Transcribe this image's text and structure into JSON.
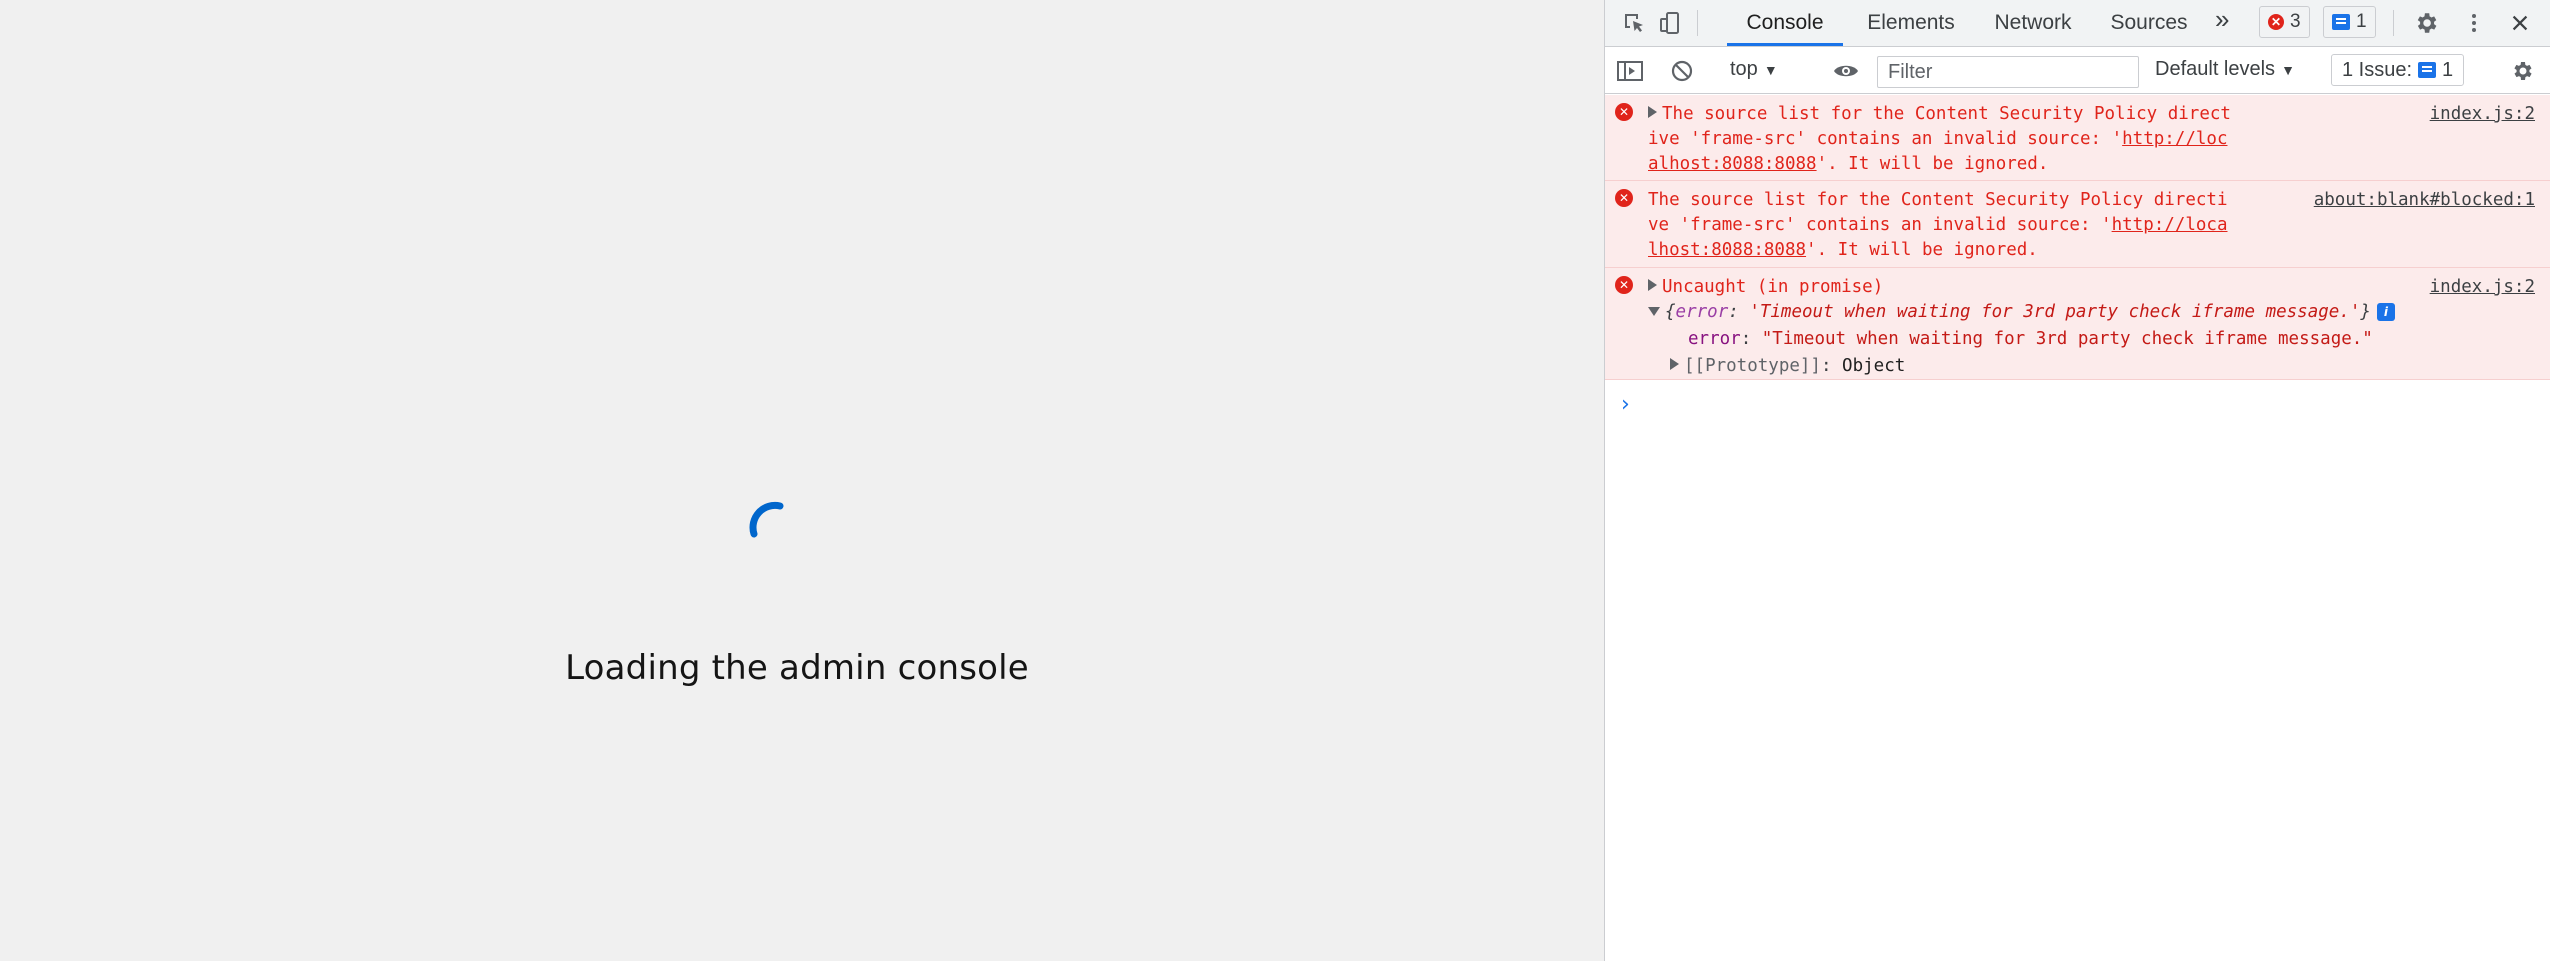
{
  "page": {
    "loading_text": "Loading the admin console"
  },
  "devtools": {
    "tabs": [
      "Console",
      "Elements",
      "Network",
      "Sources"
    ],
    "overflow_symbol": "»",
    "error_count": "3",
    "message_count": "1",
    "toolbar": {
      "context": "top",
      "filter_placeholder": "Filter",
      "levels": "Default levels",
      "issues_label": "1 Issue:",
      "issues_count": "1"
    },
    "messages": [
      {
        "prefix": "The source list for the Content Security Policy directive 'frame-src' contains an invalid source: '",
        "link": "http://localhost:8088:8088",
        "suffix": "'. It will be ignored.",
        "source": "index.js:2"
      },
      {
        "prefix": "The source list for the Content Security Policy directive 'frame-src' contains an invalid source: '",
        "link": "http://localhost:8088:8088",
        "suffix": "'. It will be ignored.",
        "source": "about:blank#blocked:1"
      },
      {
        "title": "Uncaught (in promise)",
        "source": "index.js:2",
        "object_preview_key": "error",
        "object_preview_value": "'Timeout when waiting for 3rd party check iframe message.'",
        "prop_key": "error",
        "prop_value": "\"Timeout when waiting for 3rd party check iframe message.\"",
        "prototype_key": "[[Prototype]]",
        "prototype_value": "Object"
      }
    ],
    "prompt_symbol": "›"
  },
  "colors": {
    "accent": "#1a73e8",
    "error": "#e0241b",
    "error_bg": "#fcebeb",
    "spinner": "#0066cc"
  }
}
